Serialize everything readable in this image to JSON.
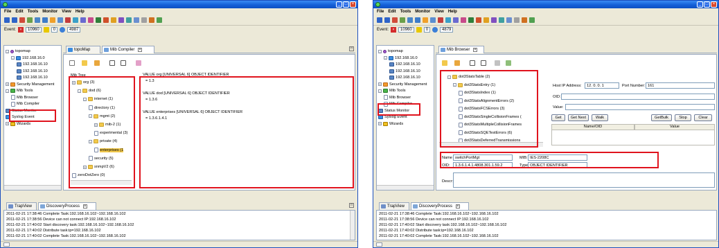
{
  "menu": [
    "File",
    "Edit",
    "Tools",
    "Monitor",
    "View",
    "Help"
  ],
  "colors": {
    "highlight": "#e0131d",
    "titlebar": "#1560d8",
    "panel_bg": "#ece9d8"
  },
  "left": {
    "event": {
      "label": "Event:",
      "count_a": "10960",
      "count_b": "0",
      "count_c": "4987"
    },
    "tabs": {
      "topomap": "topoMap",
      "compiler": "Mib Compiler"
    },
    "nav_tree": [
      {
        "label": "topomap",
        "icon": "pin-icon",
        "depth": 0,
        "exp": "-"
      },
      {
        "label": "192.168.16.0",
        "icon": "network-icon",
        "depth": 1,
        "exp": "-"
      },
      {
        "label": "192.168.16.10",
        "icon": "computer-icon",
        "depth": 2,
        "exp": ""
      },
      {
        "label": "192.168.16.10",
        "icon": "computer-icon",
        "depth": 2,
        "exp": ""
      },
      {
        "label": "192.168.16.10",
        "icon": "computer-icon",
        "depth": 2,
        "exp": ""
      },
      {
        "label": "Security Management",
        "icon": "security-icon",
        "depth": 0,
        "exp": "+"
      },
      {
        "label": "Mib Tools",
        "icon": "mib-tools-icon",
        "depth": 0,
        "exp": "-"
      },
      {
        "label": "Mib Browser",
        "icon": "doc-icon",
        "depth": 1,
        "exp": ""
      },
      {
        "label": "Mib Compiler",
        "icon": "doc-icon",
        "depth": 1,
        "exp": ""
      },
      {
        "label": "Status Monitor",
        "icon": "monitor-icon",
        "depth": 0,
        "exp": ""
      },
      {
        "label": "Syslog Event",
        "icon": "syslog-icon",
        "depth": 0,
        "exp": ""
      },
      {
        "label": "Wizards",
        "icon": "wizard-icon",
        "depth": 0,
        "exp": "+"
      }
    ],
    "mib_tree_title": "Mib Tree",
    "mib_tree": [
      {
        "label": "org (3)",
        "depth": 0,
        "exp": "+"
      },
      {
        "label": "dod (6)",
        "depth": 1,
        "exp": "-"
      },
      {
        "label": "internet (1)",
        "depth": 2,
        "exp": "-"
      },
      {
        "label": "directory (1)",
        "depth": 3,
        "exp": ""
      },
      {
        "label": "mgmt (2)",
        "depth": 3,
        "exp": "-"
      },
      {
        "label": "mib-2 (1)",
        "depth": 4,
        "exp": "+"
      },
      {
        "label": "experimental (3)",
        "depth": 4,
        "exp": ""
      },
      {
        "label": "private (4)",
        "depth": 3,
        "exp": "-"
      },
      {
        "label": "enterprises (1",
        "depth": 4,
        "exp": ""
      },
      {
        "label": "security (5)",
        "depth": 3,
        "exp": ""
      },
      {
        "label": "snmpV2 (6)",
        "depth": 2,
        "exp": "+"
      },
      {
        "label": "zeroDotZero (0)",
        "depth": 0,
        "exp": ""
      }
    ],
    "code_lines": [
      {
        "text": "VALUE org [UNIVERSAL 6] OBJECT IDENTIFIER",
        "indent": 0
      },
      {
        "text": "= 1.3",
        "indent": 1
      },
      {
        "text": "",
        "indent": 0
      },
      {
        "text": "VALUE dod [UNIVERSAL 6] OBJECT IDENTIFIER",
        "indent": 0
      },
      {
        "text": "= 1.3.6",
        "indent": 1
      },
      {
        "text": "",
        "indent": 0
      },
      {
        "text": "VALUE enterprises [UNIVERSAL 6] OBJECT IDENTIFIER",
        "indent": 0
      },
      {
        "text": "= 1.3.6.1.4.1",
        "indent": 1
      }
    ],
    "log_tabs": {
      "trapview": "TrapView",
      "discovery": "DiscoveryProcess"
    },
    "log": [
      "2011-02-21 17:38:46 Complete Task:192.168.16.102~192.168.16.102",
      "2011-02-21 17:38:56 Device can not connect IP:192.168.16.102",
      "2011-02-21 17:40:02 Start discovery task:192.168.16.102~192.168.16.102",
      "2011-02-21 17:40:02 Distribute task:ip=192.168.16.102",
      "2011-02-21 17:40:02 Complete Task:192.168.16.102~192.168.16.102"
    ]
  },
  "right": {
    "event": {
      "label": "Event:",
      "count_a": "10960",
      "count_b": "0",
      "count_c": "4879"
    },
    "tabs": {
      "browser": "Mib Browser"
    },
    "nav_tree": [
      {
        "label": "topomap",
        "icon": "pin-icon",
        "depth": 0,
        "exp": "-"
      },
      {
        "label": "192.168.16.0",
        "icon": "network-icon",
        "depth": 1,
        "exp": "-"
      },
      {
        "label": "192.168.16.10",
        "icon": "computer-icon",
        "depth": 2,
        "exp": ""
      },
      {
        "label": "192.168.16.10",
        "icon": "computer-icon",
        "depth": 2,
        "exp": ""
      },
      {
        "label": "192.168.16.10",
        "icon": "computer-icon",
        "depth": 2,
        "exp": ""
      },
      {
        "label": "Security Management",
        "icon": "security-icon",
        "depth": 0,
        "exp": "+"
      },
      {
        "label": "Mib Tools",
        "icon": "mib-tools-icon",
        "depth": 0,
        "exp": "-"
      },
      {
        "label": "Mib Browser",
        "icon": "doc-icon",
        "depth": 1,
        "exp": ""
      },
      {
        "label": "Mib Compiler",
        "icon": "doc-icon",
        "depth": 1,
        "exp": ""
      },
      {
        "label": "Status Monitor",
        "icon": "monitor-icon",
        "depth": 0,
        "exp": ""
      },
      {
        "label": "Syslog Event",
        "icon": "syslog-icon",
        "depth": 0,
        "exp": ""
      },
      {
        "label": "Wizards",
        "icon": "wizard-icon",
        "depth": 0,
        "exp": "+"
      }
    ],
    "mib_tree": [
      {
        "label": "dot3StatsTable (2)",
        "depth": 1,
        "exp": "-"
      },
      {
        "label": "dot3StatsEntry (1)",
        "depth": 2,
        "exp": "-"
      },
      {
        "label": "dot3StatsIndex (1)",
        "depth": 3,
        "exp": ""
      },
      {
        "label": "dot3StatsAlignmentErrors (2)",
        "depth": 3,
        "exp": ""
      },
      {
        "label": "dot3StatsFCSErrors (3)",
        "depth": 3,
        "exp": ""
      },
      {
        "label": "dot3StatsSingleCollisionFrames (",
        "depth": 3,
        "exp": ""
      },
      {
        "label": "dot3StatsMultipleCollisionFrames",
        "depth": 3,
        "exp": ""
      },
      {
        "label": "dot3StatsSQETestErrors (6)",
        "depth": 3,
        "exp": ""
      },
      {
        "label": "dot3StatsDeferredTransmissions",
        "depth": 3,
        "exp": ""
      }
    ],
    "host": {
      "label": "Host IP Address:",
      "value": "12. 0. 0. 1",
      "port_label": "Port Number:",
      "port_value": "161",
      "oid_label": "OID:",
      "value_label": "Value:"
    },
    "buttons": [
      "Get",
      "Get Next",
      "Walk",
      "GetBulk",
      "Stop",
      "Clear"
    ],
    "grid_heads": [
      "Name/OID",
      "Value"
    ],
    "detail": {
      "name_label": "Name",
      "name_value": "switchPortMgt",
      "mib_label": "MIB:",
      "mib_value": "IES-2208C",
      "oid_label": "OID:",
      "oid_value": "1.3.6.1.4.1.4808.301.1.59.2",
      "type_label": "Type:",
      "type_value": "OBJECT IDENTIFIER",
      "descr_label": "Descr:"
    },
    "log_tabs": {
      "trapview": "TrapView",
      "discovery": "DiscoveryProcess"
    },
    "log": [
      "2011-02-21 17:38:46 Complete Task:192.168.16.102~192.168.16.102",
      "2011-02-21 17:38:56 Device can not connect IP:192.168.16.102",
      "2011-02-21 17:40:02 Start discovery task:192.168.16.102~192.168.16.102",
      "2011-02-21 17:40:02 Distribute task:ip=192.168.16.102",
      "2011-02-21 17:40:02 Complete Task:192.168.16.102~192.168.16.102"
    ]
  }
}
